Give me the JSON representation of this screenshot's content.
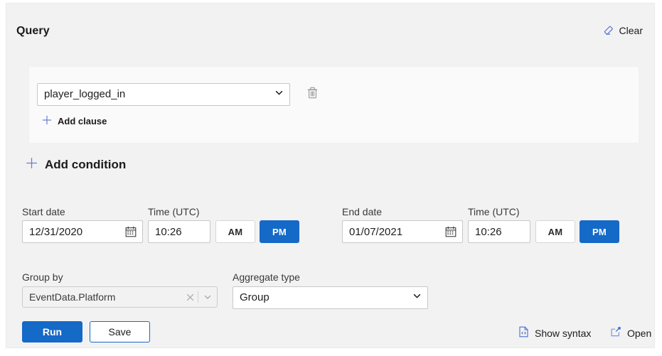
{
  "header": {
    "title": "Query",
    "clear_label": "Clear",
    "clear_icon": "eraser-icon"
  },
  "clause": {
    "event_value": "player_logged_in",
    "event_options": [
      "player_logged_in"
    ],
    "delete_icon": "trash-icon",
    "add_clause_label": "Add clause",
    "add_clause_icon": "plus-icon"
  },
  "add_condition": {
    "label": "Add condition",
    "icon": "plus-icon"
  },
  "start": {
    "date_label": "Start date",
    "date_value": "12/31/2020",
    "calendar_icon": "calendar-icon",
    "time_label": "Time (UTC)",
    "time_value": "10:26",
    "am_label": "AM",
    "pm_label": "PM",
    "meridiem_selected": "PM"
  },
  "end": {
    "date_label": "End date",
    "date_value": "01/07/2021",
    "calendar_icon": "calendar-icon",
    "time_label": "Time (UTC)",
    "time_value": "10:26",
    "am_label": "AM",
    "pm_label": "PM",
    "meridiem_selected": "PM"
  },
  "group_by": {
    "label": "Group by",
    "value": "EventData.Platform",
    "clear_icon": "close-icon",
    "dropdown_icon": "chevron-down-icon"
  },
  "aggregate": {
    "label": "Aggregate type",
    "value": "Group",
    "options": [
      "Group"
    ]
  },
  "footer": {
    "run_label": "Run",
    "save_label": "Save",
    "show_syntax_label": "Show syntax",
    "show_syntax_icon": "code-file-icon",
    "open_label": "Open",
    "open_icon": "open-external-icon"
  },
  "colors": {
    "accent_blue": "#1569c7",
    "icon_blue": "#4a6ed0",
    "card_bg": "#f2f2f2",
    "panel_bg": "#fafafa",
    "text": "#1b1b1b"
  }
}
